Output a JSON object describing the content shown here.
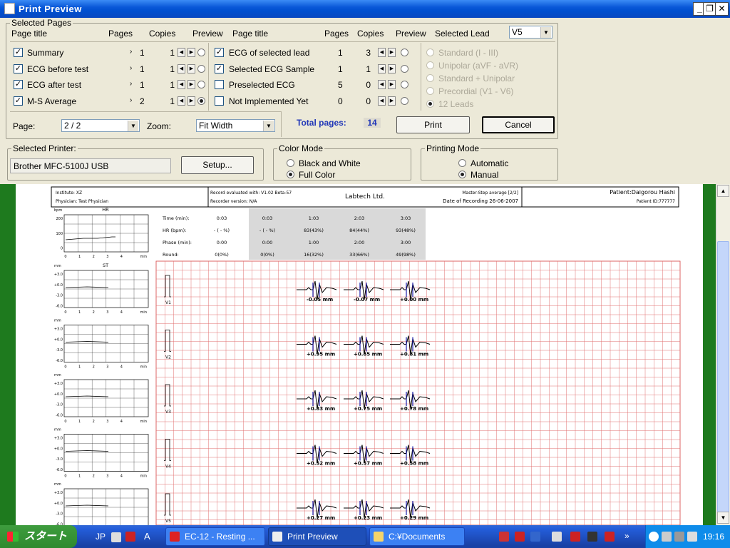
{
  "window": {
    "title": "Print Preview"
  },
  "selected_pages": {
    "group_label": "Selected Pages",
    "left_headers": {
      "page_title": "Page title",
      "pages": "Pages",
      "copies": "Copies",
      "preview": "Preview"
    },
    "right_headers": {
      "page_title": "Page title",
      "pages": "Pages",
      "copies": "Copies",
      "preview": "Preview",
      "selected_lead": "Selected Lead"
    },
    "selected_lead_value": "V5",
    "left_rows": [
      {
        "label": "Summary",
        "checked": true,
        "pages": "1",
        "copies": "1",
        "preview": false
      },
      {
        "label": "ECG before test",
        "checked": true,
        "pages": "1",
        "copies": "1",
        "preview": false
      },
      {
        "label": "ECG after test",
        "checked": true,
        "pages": "1",
        "copies": "1",
        "preview": false
      },
      {
        "label": "M-S Average",
        "checked": true,
        "pages": "2",
        "copies": "1",
        "preview": true
      }
    ],
    "right_rows": [
      {
        "label": "ECG of selected lead",
        "checked": true,
        "pages": "1",
        "copies": "3",
        "preview": false
      },
      {
        "label": "Selected ECG Sample",
        "checked": true,
        "pages": "1",
        "copies": "1",
        "preview": false
      },
      {
        "label": "Preselected ECG",
        "checked": false,
        "pages": "5",
        "copies": "0",
        "preview": false
      },
      {
        "label": "Not Implemented Yet",
        "checked": false,
        "pages": "0",
        "copies": "0",
        "preview": false
      }
    ],
    "lead_options": [
      "Standard (I - III)",
      "Unipolar (aVF - aVR)",
      "Standard + Unipolar",
      "Precordial (V1 - V6)",
      "12 Leads"
    ],
    "page_label": "Page:",
    "page_value": "2 / 2",
    "zoom_label": "Zoom:",
    "zoom_value": "Fit Width",
    "total_label": "Total pages:",
    "total_value": "14",
    "print_label": "Print",
    "cancel_label": "Cancel"
  },
  "printer": {
    "group_label": "Selected Printer:",
    "name": "Brother MFC-5100J USB",
    "setup_label": "Setup..."
  },
  "color_mode": {
    "group_label": "Color Mode",
    "options": [
      "Black and White",
      "Full Color"
    ],
    "selected": 1
  },
  "printing_mode": {
    "group_label": "Printing Mode",
    "options": [
      "Automatic",
      "Manual"
    ],
    "selected": 1
  },
  "report": {
    "institute": "Institute: XZ",
    "physician": "Physician: Test Physician",
    "record_eval": "Record evaluated with: V1.02 Beta-57",
    "recorder": "Recorder version: N/A",
    "company": "Labtech Ltd.",
    "master_step": "Master-Step average [2/2]",
    "date": "Date of Recording 26-06-2007",
    "patient": "Patient:Daigorou Hashi",
    "patient_id": "Patient ID:777777",
    "hr_title": "HR",
    "st_title": "ST",
    "table_rows": [
      {
        "label": "Time (min):",
        "cols": [
          "0:03",
          "0:03",
          "1:03",
          "2:03",
          "3:03"
        ]
      },
      {
        "label": "HR (bpm):",
        "cols": [
          "- ( - %)",
          "- ( - %)",
          "83(43%)",
          "84(44%)",
          "93(48%)"
        ]
      },
      {
        "label": "Phase (min):",
        "cols": [
          "0:00",
          "0:00",
          "1:00",
          "2:00",
          "3:00"
        ]
      },
      {
        "label": "Round:",
        "cols": [
          "0(0%)",
          "0(0%)",
          "16(32%)",
          "33(66%)",
          "49(98%)"
        ]
      }
    ],
    "lead_names": [
      "V1",
      "V2",
      "V3",
      "V4",
      "V5"
    ],
    "st_values": [
      [
        "-0.05 mm",
        "-0.07 mm",
        "+0.00 mm"
      ],
      [
        "+0.95 mm",
        "+0.85 mm",
        "+0.81 mm"
      ],
      [
        "+0.83 mm",
        "+0.75 mm",
        "+0.78 mm"
      ],
      [
        "+0.52 mm",
        "+0.57 mm",
        "+0.58 mm"
      ],
      [
        "+0.27 mm",
        "+0.23 mm",
        "+0.29 mm"
      ]
    ],
    "hr_y_ticks": [
      "200",
      "100",
      "0"
    ],
    "hr_unit": "bpm",
    "st_y_ticks": [
      "+3.0",
      "+0.0",
      "-3.0",
      "-6.0"
    ],
    "st_unit": "mm",
    "x_ticks": [
      "0",
      "1",
      "2",
      "3",
      "4"
    ],
    "x_unit": "min"
  },
  "taskbar": {
    "start_label": "スタート",
    "lang": "JP",
    "tasks": [
      "EC-12 - Resting ...",
      "Print Preview",
      "C:¥Documents an..."
    ],
    "clock": "19:16"
  }
}
